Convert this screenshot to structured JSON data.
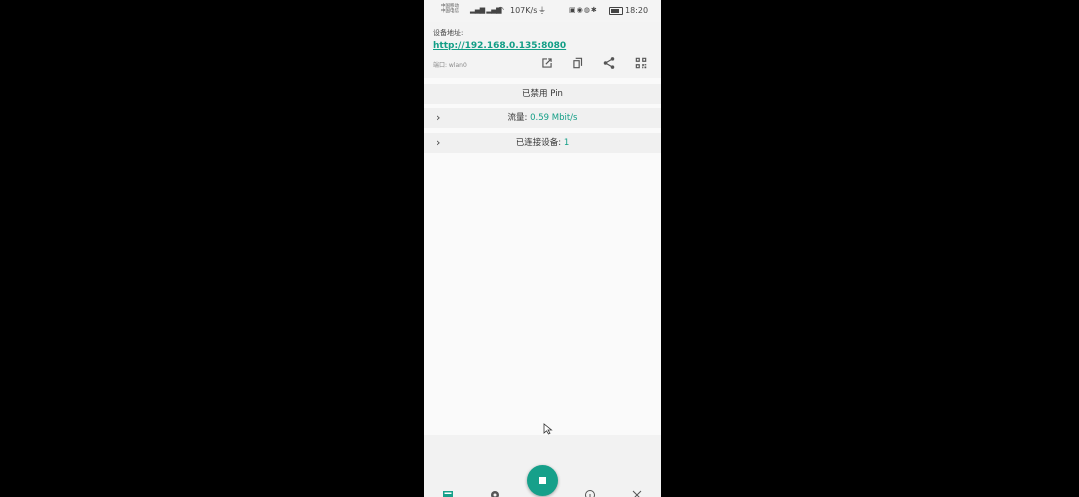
{
  "status_bar": {
    "carrier1": "中国移动",
    "carrier2": "中国电信",
    "speed": "107K/s",
    "time": "18:20"
  },
  "header": {
    "address_label": "设备地址:",
    "url": "http://192.168.0.135:8080",
    "interface": "端口: wlan0"
  },
  "pin": {
    "label": "已禁用 Pin"
  },
  "traffic": {
    "label": "流量: ",
    "value": "0.59 Mbit/s"
  },
  "devices": {
    "label": "已连接设备: ",
    "value": "1"
  },
  "colors": {
    "accent": "#129e86",
    "fab": "#16a08a"
  },
  "icons": {
    "actions": [
      "open-external-icon",
      "copy-icon",
      "share-icon",
      "qr-code-icon"
    ],
    "fab": "stop-icon",
    "nav": [
      "stream-icon",
      "settings-icon",
      "info-icon",
      "close-icon"
    ]
  }
}
